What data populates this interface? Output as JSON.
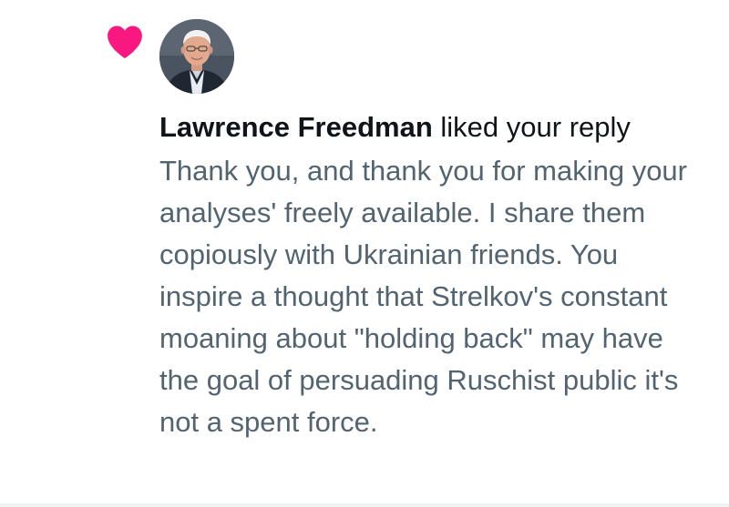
{
  "notification": {
    "type_icon": "heart-icon",
    "accent_color": "#f91880",
    "user_name": "Lawrence Freedman",
    "action_text": " liked your reply",
    "reply_text": "Thank you, and thank you for making your analyses' freely available. I share them copiously with Ukrainian friends. You inspire a thought that Strelkov's constant moaning about \"holding back\" may have the goal of persuading Ruschist public it's not a spent force."
  }
}
